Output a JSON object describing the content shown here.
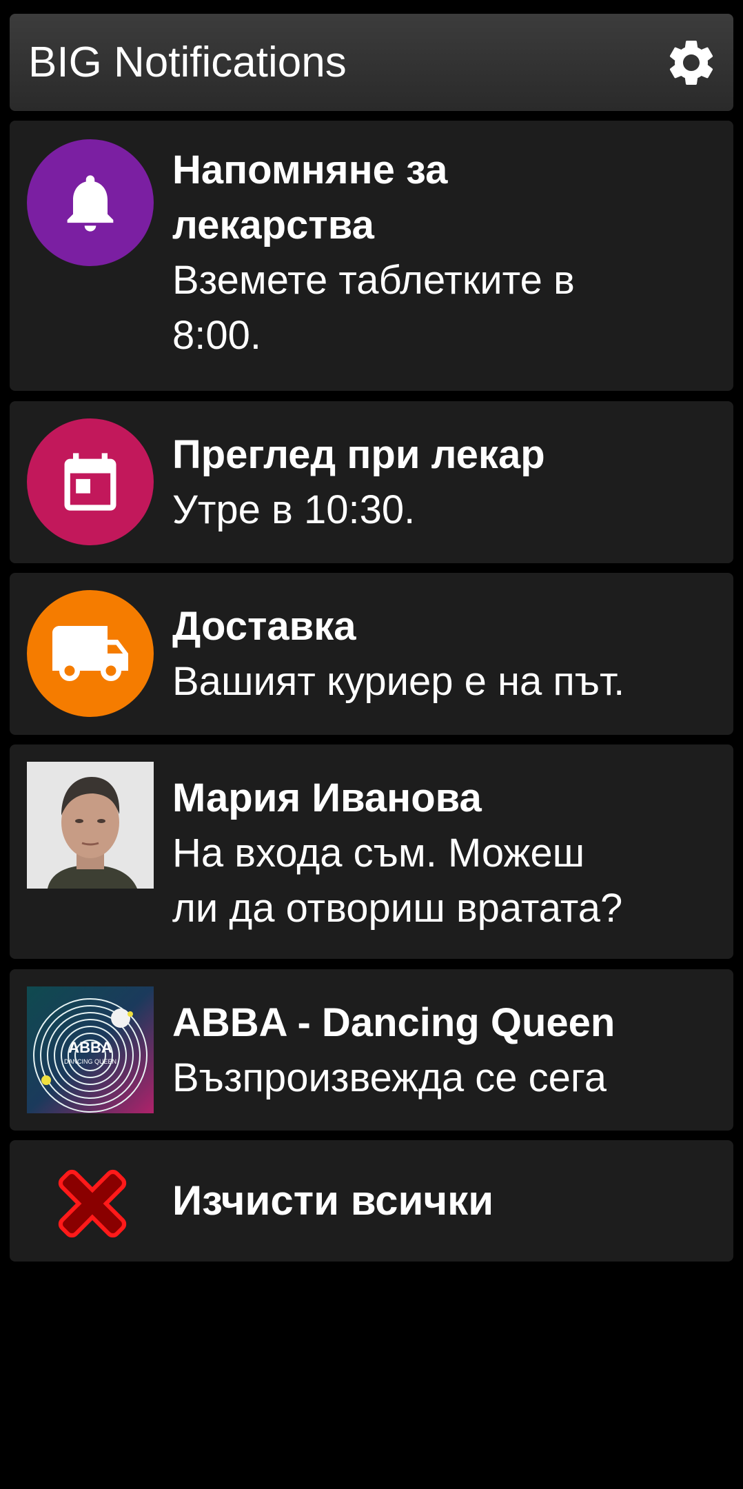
{
  "app": {
    "title": "BIG Notifications",
    "settings_icon": "gear-icon"
  },
  "notifications": [
    {
      "title_lines": [
        "Напомняне за",
        "лекарства"
      ],
      "body_lines": [
        "Вземете таблетките в",
        "8:00."
      ],
      "icon": "bell-icon",
      "icon_color": "#7b1fa2"
    },
    {
      "title_lines": [
        "Преглед при лекар"
      ],
      "body_lines": [
        "Утре в 10:30."
      ],
      "icon": "calendar-icon",
      "icon_color": "#c2185b"
    },
    {
      "title_lines": [
        "Доставка"
      ],
      "body_lines": [
        "Вашият куриер е на път."
      ],
      "icon": "truck-icon",
      "icon_color": "#f57c00"
    },
    {
      "title_lines": [
        "Мария Иванова"
      ],
      "body_lines": [
        "На входа съм. Можеш",
        "ли да отвориш вратата?"
      ],
      "icon": "contact-photo"
    },
    {
      "title_lines": [
        "ABBA - Dancing Queen"
      ],
      "body_lines": [
        "Възпроизвежда се сега"
      ],
      "icon": "album-art",
      "album_art_text": [
        "ABBA",
        "DANCING QUEEN"
      ]
    }
  ],
  "clear_all": {
    "label": "Изчисти всички",
    "icon": "red-x-icon",
    "icon_color": "#e00000"
  },
  "colors": {
    "background": "#000000",
    "card": "#1d1d1d",
    "app_bar": "#333333",
    "text": "#ffffff"
  }
}
